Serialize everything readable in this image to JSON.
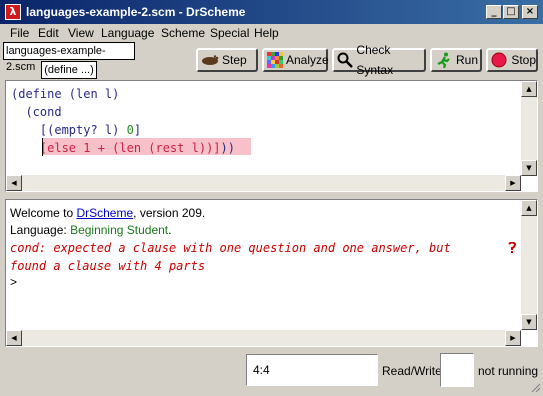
{
  "window": {
    "title": "languages-example-2.scm - DrScheme",
    "app_icon_glyph": "λ",
    "controls": {
      "minimize": "_",
      "maximize": "□",
      "close": "×"
    }
  },
  "menu": [
    "File",
    "Edit",
    "View",
    "Language",
    "Scheme",
    "Special",
    "Help"
  ],
  "toolbar": {
    "filename": "languages-example-2.scm",
    "define_popup": "(define ...)",
    "step_label": "Step",
    "analyze_label": "Analyze",
    "check_syntax_label": "Check Syntax",
    "run_label": "Run",
    "stop_label": "Stop",
    "icons": {
      "step": "footprint-icon",
      "analyze": "mosaic-icon",
      "check_syntax": "magnifier-icon",
      "run": "running-man-icon",
      "stop": "stop-circle-icon"
    }
  },
  "definitions": {
    "lines": [
      "(define (len l)",
      "  (cond",
      "    [(empty? l) 0]",
      "    [else 1 + (len (rest l))]))"
    ],
    "highlight_color": "#f8c0c8"
  },
  "interactions": {
    "welcome_prefix": "Welcome to ",
    "welcome_link": "DrScheme",
    "welcome_suffix": ", version 209.",
    "language_prefix": "Language: ",
    "language_value": "Beginning Student",
    "language_suffix": ".",
    "error_line1": "cond: expected a clause with one question and one answer, but",
    "error_line2": "found a clause with 4 parts",
    "prompt": ">"
  },
  "status": {
    "position": "4:4",
    "mode": "Read/Write",
    "running": "not running"
  },
  "colors": {
    "keyword": "#2a2a86",
    "link": "#0000cc",
    "language": "#1a7a1a",
    "number": "#2a8a2a",
    "error": "#cc0000"
  }
}
